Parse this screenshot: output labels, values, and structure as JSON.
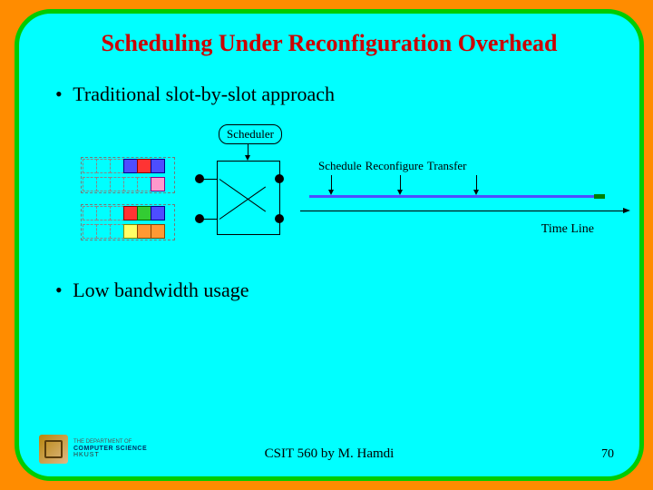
{
  "title": "Scheduling Under Reconfiguration Overhead",
  "bullets": {
    "b1": "Traditional slot-by-slot approach",
    "b2": "Low bandwidth usage"
  },
  "diagram": {
    "scheduler_label": "Scheduler",
    "phase1": "Schedule",
    "phase2": "Reconfigure",
    "phase3": "Transfer",
    "timeline_label": "Time Line"
  },
  "footer": {
    "credit": "CSIT 560 by M. Hamdi",
    "page": "70"
  },
  "logo": {
    "line1": "THE DEPARTMENT OF",
    "line2": "COMPUTER SCIENCE",
    "line3": "HKUST"
  }
}
